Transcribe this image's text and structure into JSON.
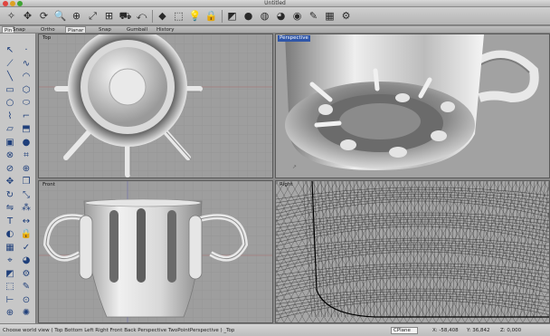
{
  "window": {
    "title": "Untitled"
  },
  "toolbar": {
    "buttons": [
      {
        "name": "new-file-icon",
        "glyph": "✧"
      },
      {
        "name": "pan-icon",
        "glyph": "✥"
      },
      {
        "name": "rotate-view-icon",
        "glyph": "⟳"
      },
      {
        "name": "zoom-icon",
        "glyph": "🔍"
      },
      {
        "name": "zoom-window-icon",
        "glyph": "⊕"
      },
      {
        "name": "zoom-extents-icon",
        "glyph": "⤢"
      },
      {
        "name": "four-viewports-icon",
        "glyph": "⊞"
      },
      {
        "name": "car-icon",
        "glyph": "⛟"
      },
      {
        "name": "undo-view-icon",
        "glyph": "⤺"
      },
      {
        "name": "select-icon",
        "glyph": "◆"
      },
      {
        "name": "crop-icon",
        "glyph": "⬚"
      },
      {
        "name": "light-icon",
        "glyph": "💡"
      },
      {
        "name": "lock-icon",
        "glyph": "🔒"
      },
      {
        "name": "layer-icon",
        "glyph": "◩"
      },
      {
        "name": "shaded-sphere-icon",
        "glyph": "●"
      },
      {
        "name": "wireframe-sphere-icon",
        "glyph": "◍"
      },
      {
        "name": "render-sphere-icon",
        "glyph": "◕"
      },
      {
        "name": "earth-icon",
        "glyph": "◉"
      },
      {
        "name": "paint-icon",
        "glyph": "✎"
      },
      {
        "name": "grid-icon",
        "glyph": "▦"
      },
      {
        "name": "settings-icon",
        "glyph": "⚙"
      }
    ]
  },
  "tabs": [
    "Snap",
    "Ortho",
    "Planar",
    "Snap",
    "Gumball",
    "History"
  ],
  "pin_label": "Pin",
  "viewports": {
    "top": "Top",
    "perspective": "Perspective",
    "front": "Front",
    "right": "Right"
  },
  "status": {
    "command": "Choose world view ( Top Bottom Left Right Front Back Perspective TwoPointPerspective ) _Top",
    "cplane": "CPlane",
    "x": "X: -58,408",
    "y": "Y: 36,842",
    "z": "Z: 0,000"
  },
  "colors": {
    "accent": "#2f56a8",
    "viewport_bg": "#9e9e9e"
  }
}
